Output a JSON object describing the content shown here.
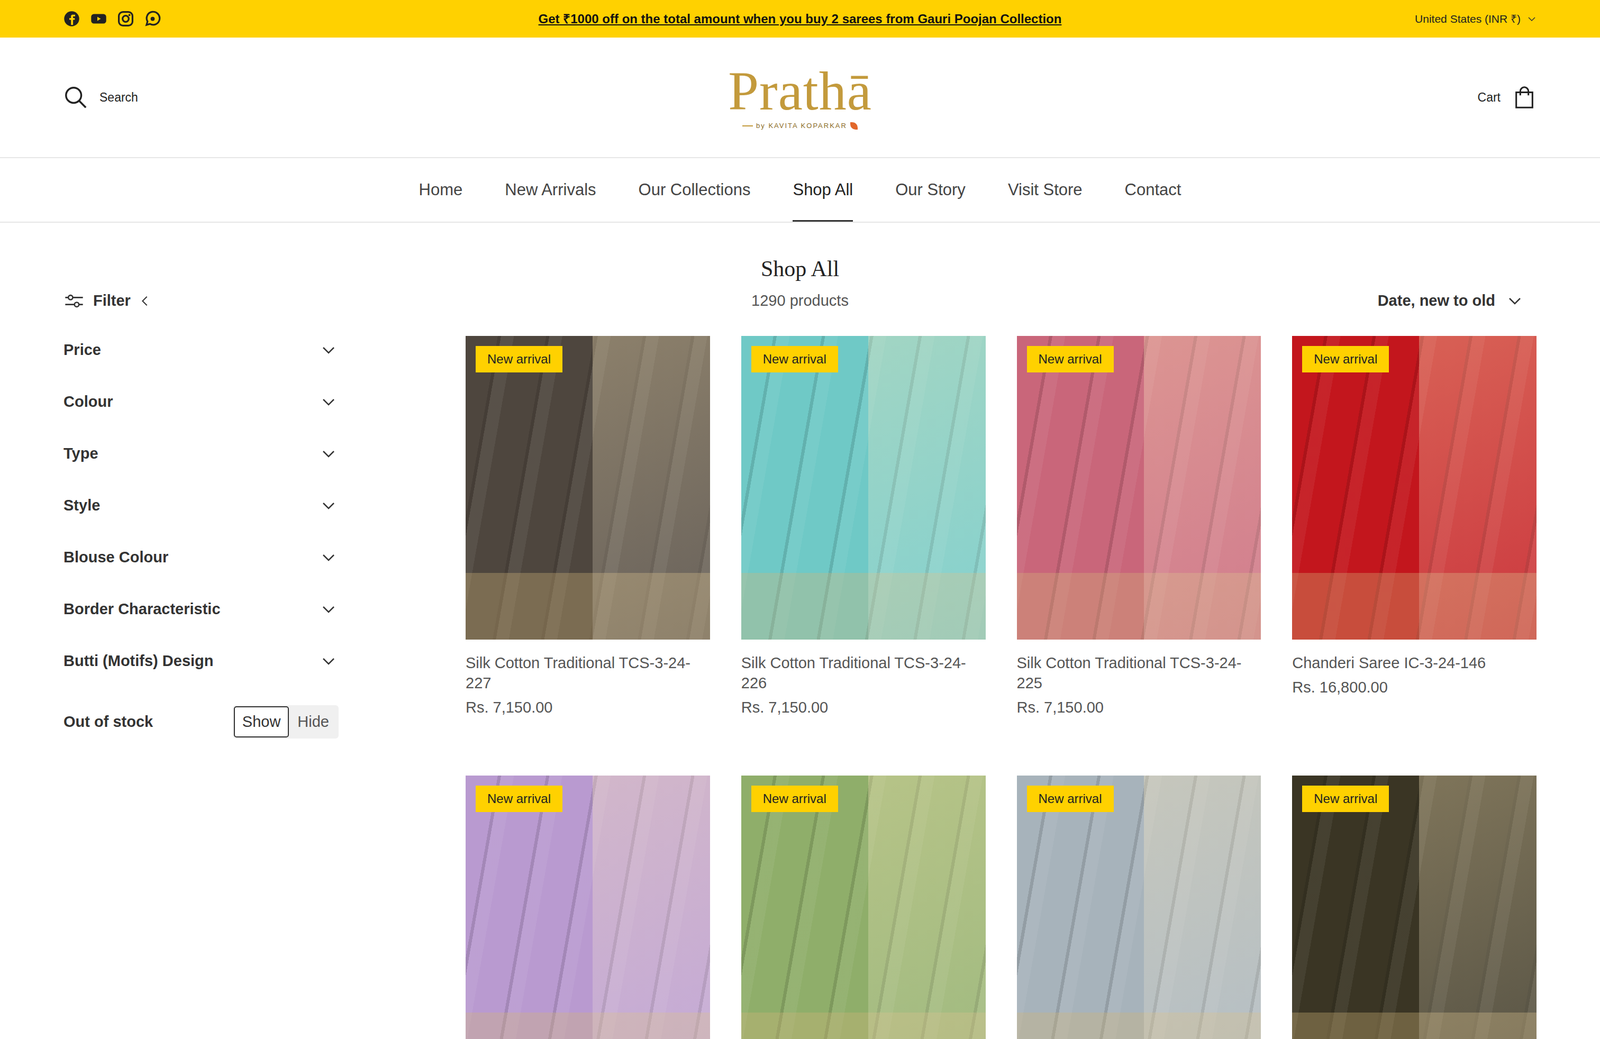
{
  "announcement": {
    "text": "Get ₹1000 off on the total amount when you buy 2 sarees from Gauri Poojan Collection",
    "locale": "United States (INR ₹)"
  },
  "header": {
    "search": "Search",
    "logo": "Prathā",
    "logo_tagline": "by KAVITA KOPARKAR",
    "cart": "Cart"
  },
  "nav": [
    {
      "label": "Home",
      "selected": false
    },
    {
      "label": "New Arrivals",
      "selected": false
    },
    {
      "label": "Our Collections",
      "selected": false
    },
    {
      "label": "Shop All",
      "selected": true
    },
    {
      "label": "Our Story",
      "selected": false
    },
    {
      "label": "Visit Store",
      "selected": false
    },
    {
      "label": "Contact",
      "selected": false
    }
  ],
  "page": {
    "title": "Shop All",
    "count": "1290 products",
    "sort": "Date, new to old"
  },
  "filters": {
    "label": "Filter",
    "groups": [
      {
        "label": "Price",
        "expanded": false
      },
      {
        "label": "Colour",
        "expanded": false
      },
      {
        "label": "Type",
        "expanded": false
      },
      {
        "label": "Style",
        "expanded": false
      },
      {
        "label": "Blouse Colour",
        "expanded": false
      },
      {
        "label": "Border Characteristic",
        "expanded": false
      },
      {
        "label": "Butti (Motifs) Design",
        "expanded": false
      }
    ],
    "stock": {
      "label": "Out of stock",
      "options": [
        {
          "label": "Show",
          "selected": true
        },
        {
          "label": "Hide",
          "selected": false
        }
      ]
    }
  },
  "products": [
    {
      "badge": "New arrival",
      "name": "Silk Cotton Traditional TCS-3-24-227",
      "price": "Rs. 7,150.00",
      "color": "#4e463e"
    },
    {
      "badge": "New arrival",
      "name": "Silk Cotton Traditional TCS-3-24-226",
      "price": "Rs. 7,150.00",
      "color": "#6fc9c6"
    },
    {
      "badge": "New arrival",
      "name": "Silk Cotton Traditional TCS-3-24-225",
      "price": "Rs. 7,150.00",
      "color": "#c9667a"
    },
    {
      "badge": "New arrival",
      "name": "Chanderi Saree IC-3-24-146",
      "price": "Rs. 16,800.00",
      "color": "#c3161d"
    },
    {
      "badge": "New arrival",
      "color": "#b99ad0"
    },
    {
      "badge": "New arrival",
      "color": "#8fae6a"
    },
    {
      "badge": "New arrival",
      "color": "#a7b3bb"
    },
    {
      "badge": "New arrival",
      "color": "#3a3524"
    }
  ]
}
